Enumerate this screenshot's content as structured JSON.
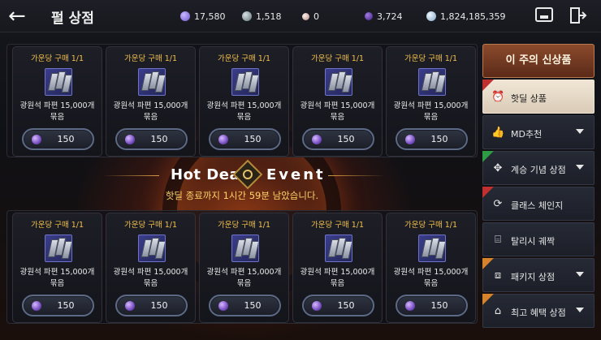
{
  "header": {
    "title": "펄 상점",
    "currencies": [
      {
        "icon": "currency-purple-icon",
        "value": "17,580",
        "color": "#8f7bd9"
      },
      {
        "icon": "currency-silver-icon",
        "value": "1,518",
        "color": "#8aa0a6"
      },
      {
        "icon": "currency-pearl-icon",
        "value": "0",
        "color": "#d9b8b0"
      },
      {
        "icon": "currency-violet-icon",
        "value": "3,724",
        "color": "#6b3fbf"
      },
      {
        "icon": "currency-blue-icon",
        "value": "1,824,185,359",
        "color": "#9fc6e6"
      }
    ]
  },
  "top_grid": {
    "cards": [
      {
        "limit": "가운당 구매 1/1",
        "name_line1": "광원석 파편 15,000개",
        "name_line2": "묶음",
        "price": "150"
      },
      {
        "limit": "가운당 구매 1/1",
        "name_line1": "광원석 파편 15,000개",
        "name_line2": "묶음",
        "price": "150"
      },
      {
        "limit": "가운당 구매 1/1",
        "name_line1": "광원석 파편 15,000개",
        "name_line2": "묶음",
        "price": "150"
      },
      {
        "limit": "가운당 구매 1/1",
        "name_line1": "광원석 파편 15,000개",
        "name_line2": "묶음",
        "price": "150"
      },
      {
        "limit": "가운당 구매 1/1",
        "name_line1": "광원석 파편 15,000개",
        "name_line2": "묶음",
        "price": "150"
      }
    ]
  },
  "banner": {
    "hot": "Hot Deal",
    "event": "Event",
    "message": "핫딜 종료까지 1시간 59분 남았습니다."
  },
  "bottom_grid": {
    "cards": [
      {
        "limit": "가운당 구매 1/1",
        "name_line1": "광원석 파편 15,000개",
        "name_line2": "묶음",
        "price": "150"
      },
      {
        "limit": "가운당 구매 1/1",
        "name_line1": "광원석 파편 15,000개",
        "name_line2": "묶음",
        "price": "150"
      },
      {
        "limit": "가운당 구매 1/1",
        "name_line1": "광원석 파편 15,000개",
        "name_line2": "묶음",
        "price": "150"
      },
      {
        "limit": "가운당 구매 1/1",
        "name_line1": "광원석 파편 15,000개",
        "name_line2": "묶음",
        "price": "150"
      },
      {
        "limit": "가운당 구매 1/1",
        "name_line1": "광원석 파편 15,000개",
        "name_line2": "묶음",
        "price": "150"
      }
    ]
  },
  "sidebar": {
    "header_label": "이 주의 신상품",
    "items": [
      {
        "label": "핫딜 상품",
        "icon": "alarm-clock-icon",
        "active": true,
        "caret": false,
        "tag": "red"
      },
      {
        "label": "MD추천",
        "icon": "thumbs-up-icon",
        "active": false,
        "caret": true,
        "tag": ""
      },
      {
        "label": "계승 기념 상점",
        "icon": "crest-icon",
        "active": false,
        "caret": true,
        "tag": "green"
      },
      {
        "label": "클래스 체인지",
        "icon": "refresh-icon",
        "active": false,
        "caret": false,
        "tag": "red"
      },
      {
        "label": "탈리시 궤짝",
        "icon": "chest-icon",
        "active": false,
        "caret": false,
        "tag": ""
      },
      {
        "label": "패키지 상점",
        "icon": "package-icon",
        "active": false,
        "caret": true,
        "tag": "orange"
      },
      {
        "label": "최고 혜택 상점",
        "icon": "gift-icon",
        "active": false,
        "caret": true,
        "tag": "orange"
      }
    ]
  }
}
